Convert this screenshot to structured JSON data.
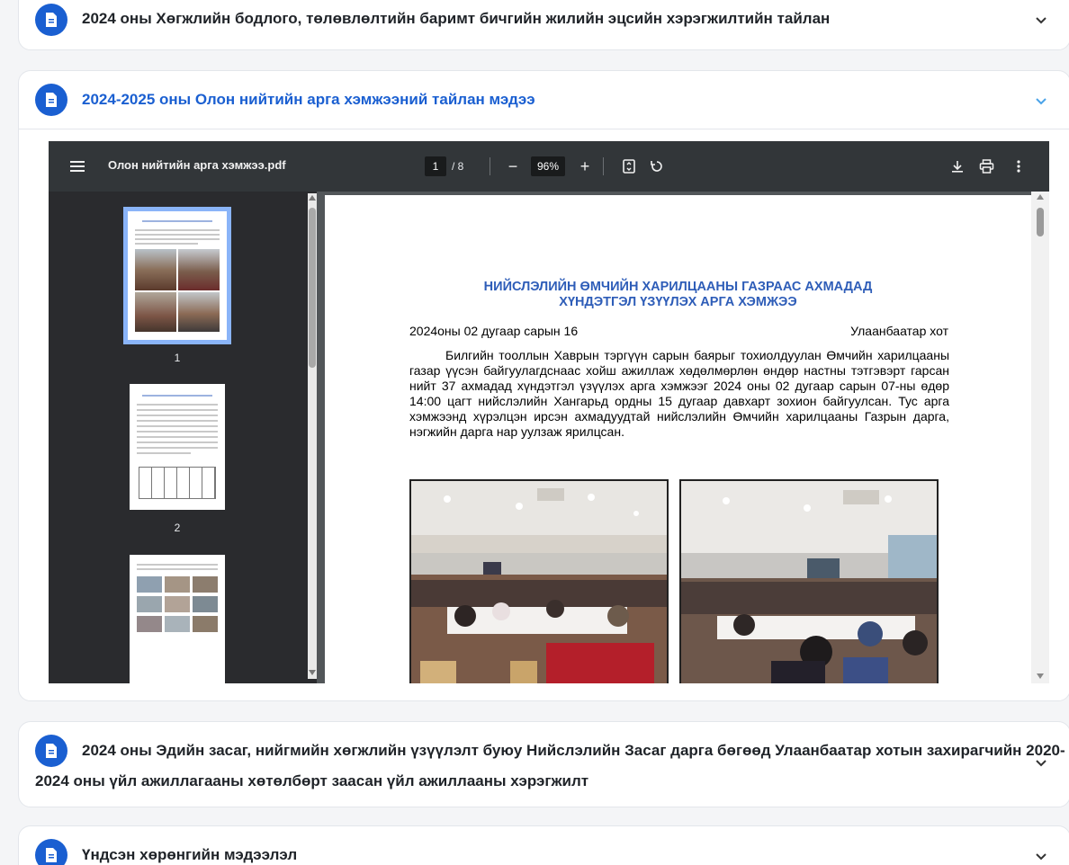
{
  "accordion": {
    "item1": {
      "title": "2024 оны Хөгжлийн бодлого, төлөвлөлтийн баримт бичгийн жилийн эцсийн хэрэгжилтийн тайлан"
    },
    "item2": {
      "title": "2024-2025 оны Олон нийтийн арга хэмжээний тайлан мэдээ"
    },
    "item3": {
      "title_line1": "2024 оны Эдийн засаг, нийгмийн хөгжлийн үзүүлэлт буюу Нийслэлийн Засаг дарга бөгөөд Улаанбаатар хотын захирагчийн 2020-",
      "title_line2": "2024 оны үйл ажиллагааны хөтөлбөрт заасан үйл ажиллааны хэрэгжилт"
    },
    "item4": {
      "title": "Үндсэн хөрөнгийн мэдээлэл"
    }
  },
  "pdf_viewer": {
    "file_name": "Олон нийтийн арга хэмжээ.pdf",
    "current_page": "1",
    "page_total": "/ 8",
    "zoom": "96%",
    "thumbnails": [
      {
        "number": "1"
      },
      {
        "number": "2"
      }
    ]
  },
  "document": {
    "title_line1": "НИЙСЛЭЛИЙН ӨМЧИЙН ХАРИЛЦААНЫ ГАЗРААС АХМАДАД",
    "title_line2": "ХҮНДЭТГЭЛ ҮЗҮҮЛЭХ АРГА ХЭМЖЭЭ",
    "date": "2024оны 02 дугаар сарын 16",
    "city": "Улаанбаатар хот",
    "body": "Билгийн тооллын Хаврын тэргүүн сарын баярыг тохиолдуулан Өмчийн харилцааны газар үүсэн байгуулагдснаас хойш ажиллаж хөдөлмөрлөн өндөр настны тэтгэвэрт гарсан нийт 37 ахмадад хүндэтгэл үзүүлэх арга хэмжээг 2024 оны 02 дугаар сарын 07-ны өдөр 14:00 цагт нийслэлийн Хангарьд ордны 15 дугаар давхарт зохион байгуулсан. Тус арга хэмжээнд хүрэлцэн ирсэн ахмадуудтай нийслэлийн Өмчийн харилцааны Газрын дарга, нэгжийн дарга нар уулзаж ярилцсан."
  },
  "colors": {
    "accent": "#1a5fd1",
    "toolbar": "#323639",
    "sidebar": "#2a2b2e",
    "viewer_bg": "#525659",
    "doc_title": "#2e5db8"
  },
  "icons": [
    "document-icon",
    "chevron-down-icon",
    "chevron-up-icon",
    "menu-icon",
    "fit-page-icon",
    "rotate-icon",
    "download-icon",
    "print-icon",
    "more-vert-icon"
  ]
}
